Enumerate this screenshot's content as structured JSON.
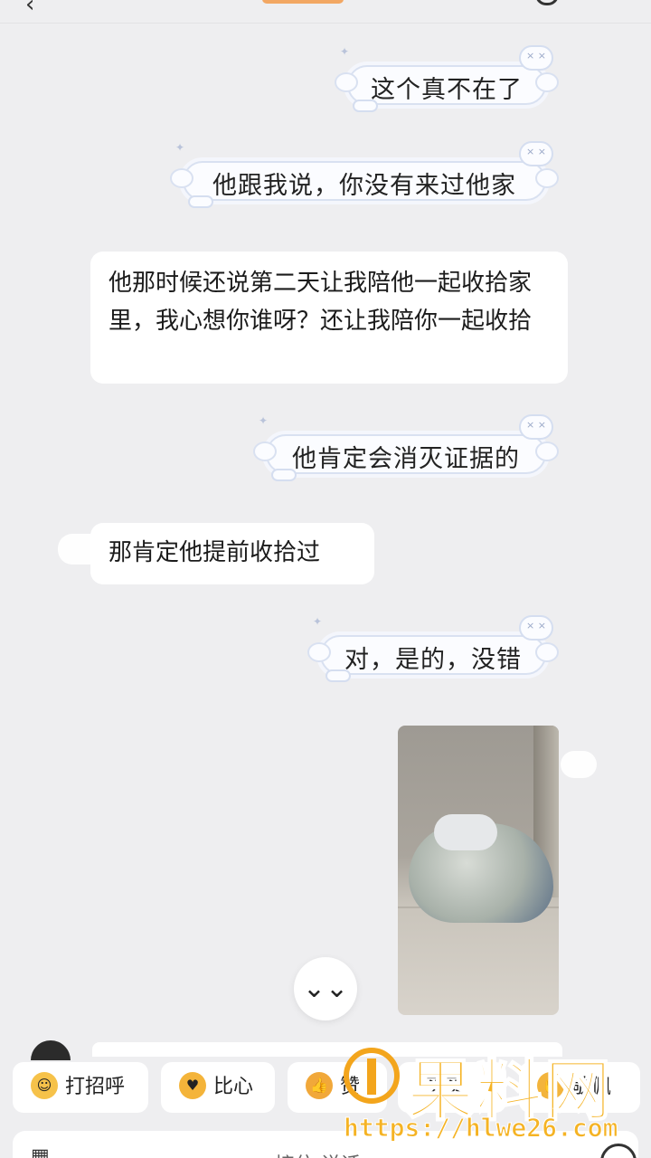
{
  "messages": {
    "m1": "这个真不在了",
    "m2": "他跟我说，你没有来过他家",
    "m3": "他那时候还说第二天让我陪他一起收拾家里，我心想你谁呀？还让我陪你一起收拾",
    "m4": "他肯定会消灭证据的",
    "m5": "那肯定他提前收拾过",
    "m6": "对，是的，没错"
  },
  "scroll_button": "⌄⌄",
  "quick_replies": {
    "chip1": "打招呼",
    "chip2": "比心",
    "chip3": "赞",
    "chip4": "买买",
    "chip5": "敬佩"
  },
  "input": {
    "hint": "接住 说话"
  },
  "watermark": {
    "brand": "果料网",
    "url": "https://hlwe26.com"
  },
  "colors": {
    "background": "#eeeef0",
    "bubble": "#ffffff",
    "cloud_border": "#d9e1f1",
    "watermark": "#f5b324"
  },
  "icons": [
    "back-icon",
    "menu-icon",
    "grid-icon",
    "more-icon",
    "chevron-double-down-icon"
  ]
}
